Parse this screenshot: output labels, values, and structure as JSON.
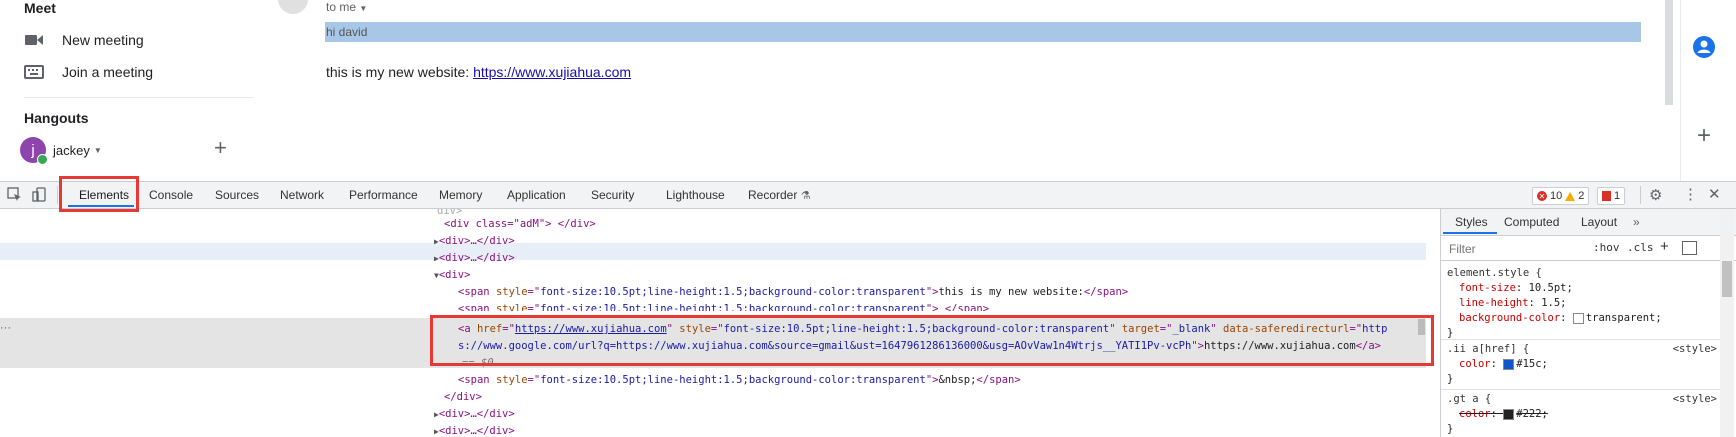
{
  "gmail": {
    "meet": {
      "title": "Meet",
      "new_meeting": "New meeting",
      "join_meeting": "Join a meeting"
    },
    "hangouts": {
      "title": "Hangouts",
      "user": "jackey",
      "avatar_letter": "j"
    },
    "message": {
      "to_me": "to me",
      "greeting": "hi david",
      "body_text": "this is my new website: ",
      "link": "https://www.xujiahua.com"
    }
  },
  "devtools": {
    "tabs": [
      "Elements",
      "Console",
      "Sources",
      "Network",
      "Performance",
      "Memory",
      "Application",
      "Security",
      "Lighthouse",
      "Recorder"
    ],
    "errors": "10",
    "warnings": "2",
    "issues": "1",
    "code_lines": {
      "l0": "<div class=\"adM\"> </div>",
      "l1_open": "<div>",
      "l1_dots": "…",
      "l1_close": "</div>",
      "l4_text": "this is my new website:",
      "l5_text": " ",
      "span_style": "font-size:10.5pt;line-height:1.5;background-color:transparent",
      "a_href": "https://www.xujiahua.com",
      "a_target": "_blank",
      "a_saferedirect_1": "http",
      "a_saferedirect_2": "s://www.google.com/url?q=https://www.xujiahua.com&source=gmail&ust=1647961286136000&usg=AOvVaw1n4Wtrjs__YATI1Pv-vcPh",
      "a_text": "https://www.xujiahua.com",
      "eq0": "== $0",
      "nbsp": "&nbsp;"
    },
    "styles": {
      "tabs": [
        "Styles",
        "Computed",
        "Layout"
      ],
      "filter_placeholder": "Filter",
      "hov": ":hov",
      "cls": ".cls",
      "element_style": "element.style {",
      "es_props": [
        {
          "name": "font-size",
          "value": "10.5pt;"
        },
        {
          "name": "line-height",
          "value": "1.5;"
        },
        {
          "name": "background-color",
          "value": "transparent;"
        }
      ],
      "rule2_selector": ".ii a[href] {",
      "rule2_source": "<style>",
      "rule2_prop": "color",
      "rule2_value": "#15c;",
      "rule3_selector": ".gt a {",
      "rule3_source": "<style>",
      "rule3_prop": "color",
      "rule3_value": "#222;",
      "close_brace": "}"
    },
    "colors": {
      "accent": "#1a73e8",
      "highlight_box": "#e53935",
      "link_color": "#1155cc",
      "strike_color": "#222222"
    }
  }
}
